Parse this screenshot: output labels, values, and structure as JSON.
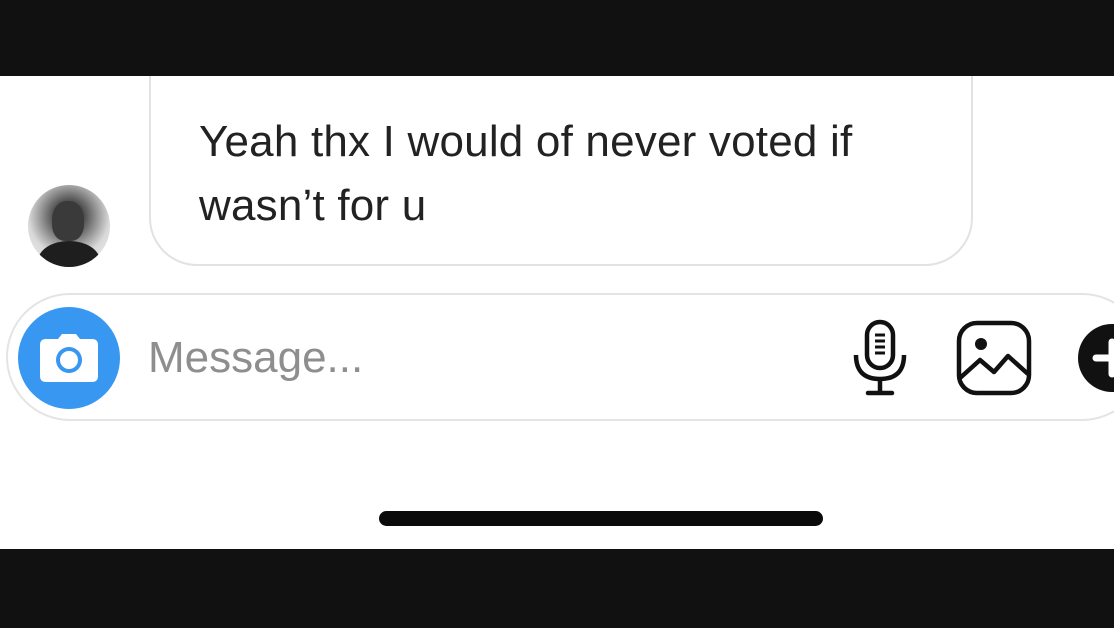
{
  "conversation": {
    "messages": [
      {
        "sender": "other",
        "text_line1": "Yeah thx I would of never voted if",
        "text_line2": "wasn’t for u"
      }
    ]
  },
  "composer": {
    "placeholder": "Message...",
    "icons": {
      "camera": "camera-icon",
      "microphone": "microphone-icon",
      "gallery": "gallery-icon",
      "more": "plus-icon"
    }
  },
  "colors": {
    "camera_button": "#3897f0",
    "placeholder_text": "#8e8e8e",
    "message_text": "#222222",
    "bubble_border": "#e2e2e2",
    "letterbox": "#111111"
  }
}
